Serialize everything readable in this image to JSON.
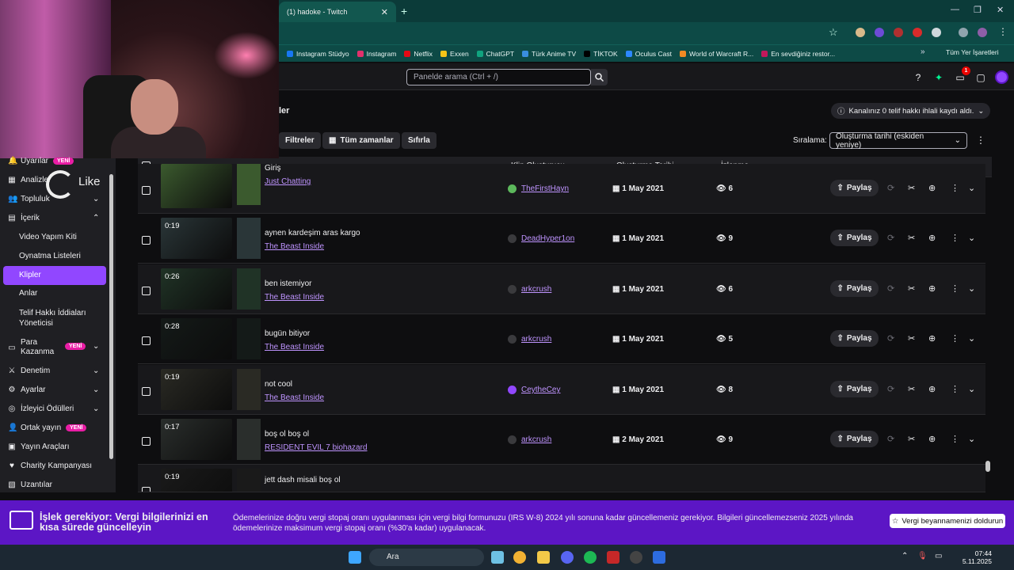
{
  "browser": {
    "tab_title": "(1) hadoke - Twitch",
    "close": "✕",
    "newtab": "+",
    "min": "—",
    "max": "❐",
    "close_win": "✕",
    "star": "☆"
  },
  "bookmarks": [
    {
      "label": "Instagram Stüdyo",
      "color": "#1877f2"
    },
    {
      "label": "Instagram",
      "color": "#e1306c"
    },
    {
      "label": "Netflix",
      "color": "#e50914"
    },
    {
      "label": "Exxen",
      "color": "#f5c518"
    },
    {
      "label": "ChatGPT",
      "color": "#10a37f"
    },
    {
      "label": "Türk Anime TV",
      "color": "#3a8dde"
    },
    {
      "label": "TİKTOK",
      "color": "#000000"
    },
    {
      "label": "Oculus Cast",
      "color": "#2d88ff"
    },
    {
      "label": "World of Warcraft R...",
      "color": "#f08a24"
    },
    {
      "label": "En sevdiğiniz restor...",
      "color": "#c2185b"
    }
  ],
  "bookmarks_more": "»",
  "bookmarks_all": "Tüm Yer İşaretleri",
  "topnav": {
    "search_placeholder": "Panelde arama (Ctrl + /)",
    "notif_count": "1"
  },
  "overlay": {
    "like": "Like"
  },
  "sidebar": {
    "items": [
      {
        "label": "Uyarılar",
        "icon": "bell-icon",
        "glyph": "🔔",
        "badge": "YENİ"
      },
      {
        "label": "Analizler",
        "icon": "chart-icon",
        "glyph": "▦"
      },
      {
        "label": "Topluluk",
        "icon": "people-icon",
        "glyph": "👥",
        "chev": "⌄"
      },
      {
        "label": "İçerik",
        "icon": "content-icon",
        "glyph": "▤",
        "chev": "⌃"
      },
      {
        "label": "Para Kazanma",
        "icon": "money-icon",
        "glyph": "▭",
        "badge": "YENİ",
        "chev": "⌄"
      },
      {
        "label": "Denetim",
        "icon": "sword-icon",
        "glyph": "⚔",
        "chev": "⌄"
      },
      {
        "label": "Ayarlar",
        "icon": "gear-icon",
        "glyph": "⚙",
        "chev": "⌄"
      },
      {
        "label": "İzleyici Ödülleri",
        "icon": "reward-icon",
        "glyph": "◎",
        "chev": "⌄"
      },
      {
        "label": "Ortak yayın",
        "icon": "collab-icon",
        "glyph": "👤",
        "badge": "YENİ"
      },
      {
        "label": "Yayın Araçları",
        "icon": "tools-icon",
        "glyph": "▣"
      },
      {
        "label": "Charity Kampanyası",
        "icon": "charity-icon",
        "glyph": "♥"
      },
      {
        "label": "Uzantılar",
        "icon": "extensions-icon",
        "glyph": "▧"
      }
    ],
    "content_sub": [
      "Video Yapım Kiti",
      "Oynatma Listeleri",
      "Klipler",
      "Anlar",
      "Telif Hakkı İddiaları Yöneticisi"
    ]
  },
  "page": {
    "title": "ler",
    "claim": "Kanalınız 0 telif hakkı ihlali kaydı aldı.",
    "filters": "Filtreler",
    "time": "Tüm zamanlar",
    "reset": "Sıfırla",
    "sort_label": "Sıralama:",
    "sort_value": "Oluşturma tarihi (eskiden yeniye)"
  },
  "columns": {
    "creator": "Klip Oluşturucu",
    "created": "Oluşturma Tarihi",
    "views": "İzlenme"
  },
  "share_label": "Paylaş",
  "clips": [
    {
      "duration": "",
      "title": "Giriş",
      "game": "Just Chatting",
      "creator": "TheFirstHayn",
      "date": "1 May 2021",
      "views": "6",
      "av": "#5cb85c",
      "th": "#3b5a2e"
    },
    {
      "duration": "0:19",
      "title": "aynen kardeşim aras kargo",
      "game": "The Beast Inside",
      "creator": "DeadHyper1on",
      "date": "1 May 2021",
      "views": "9",
      "av": "#3a3a3d",
      "th": "#2a3638"
    },
    {
      "duration": "0:26",
      "title": "ben istemiyor",
      "game": "The Beast Inside",
      "creator": "arkcrush",
      "date": "1 May 2021",
      "views": "6",
      "av": "#3a3a3d",
      "th": "#203326"
    },
    {
      "duration": "0:28",
      "title": "bugün bitiyor",
      "game": "The Beast Inside",
      "creator": "arkcrush",
      "date": "1 May 2021",
      "views": "5",
      "av": "#3a3a3d",
      "th": "#141a18"
    },
    {
      "duration": "0:19",
      "title": "not cool",
      "game": "The Beast Inside",
      "creator": "CeytheCey",
      "date": "1 May 2021",
      "views": "8",
      "av": "#9147ff",
      "th": "#2a2a24"
    },
    {
      "duration": "0:17",
      "title": "boş ol boş ol",
      "game": "RESIDENT EVIL 7 biohazard",
      "creator": "arkcrush",
      "date": "2 May 2021",
      "views": "9",
      "av": "#3a3a3d",
      "th": "#2a2e2c"
    },
    {
      "duration": "0:19",
      "title": "jett dash misali boş ol",
      "game": "",
      "creator": "",
      "date": "",
      "views": "",
      "av": "#3a3a3d",
      "th": "#1a1a1a"
    }
  ],
  "banner": {
    "title": "İşlek gerekiyor: Vergi bilgilerinizi en kısa sürede güncelleyin",
    "text": "Ödemelerinize doğru vergi stopaj oranı uygulanması için vergi bilgi formunuzu (IRS W-8) 2024 yılı sonuna kadar güncellemeniz gerekiyor. Bilgileri güncellemezseniz 2025 yılında ödemelerinize maksimum vergi stopaj oranı (%30'a kadar) uygulanacak.",
    "button": "Vergi beyannamenizi doldurun"
  },
  "taskbar": {
    "search": "Ara",
    "time": "07:44",
    "date": "5.11.2025"
  }
}
